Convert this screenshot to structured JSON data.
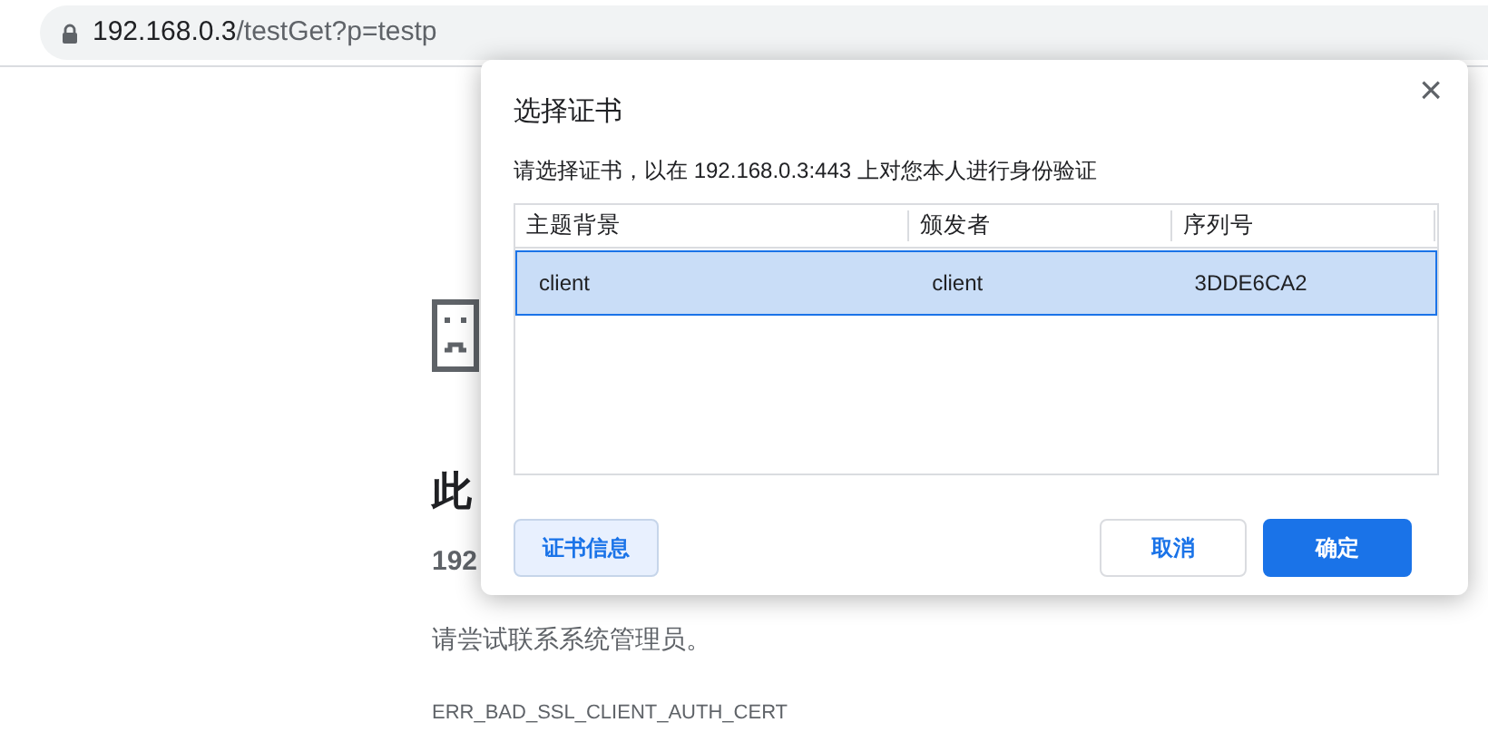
{
  "address_bar": {
    "host": "192.168.0.3",
    "path": "/testGet?p=testp"
  },
  "error_page": {
    "title": "此",
    "host": "192",
    "hint": "请尝试联系系统管理员。",
    "code": "ERR_BAD_SSL_CLIENT_AUTH_CERT"
  },
  "dialog": {
    "title": "选择证书",
    "close": "×",
    "message": "请选择证书，以在 192.168.0.3:443 上对您本人进行身份验证",
    "table": {
      "columns": [
        "主题背景",
        "颁发者",
        "序列号"
      ],
      "rows": [
        {
          "cells": [
            "client",
            "client",
            "3DDE6CA2"
          ],
          "selected": true
        }
      ]
    },
    "info_button": "证书信息",
    "buttons": [
      {
        "label": "取消",
        "kind": "secondary"
      },
      {
        "label": "确定",
        "kind": "primary"
      }
    ]
  }
}
